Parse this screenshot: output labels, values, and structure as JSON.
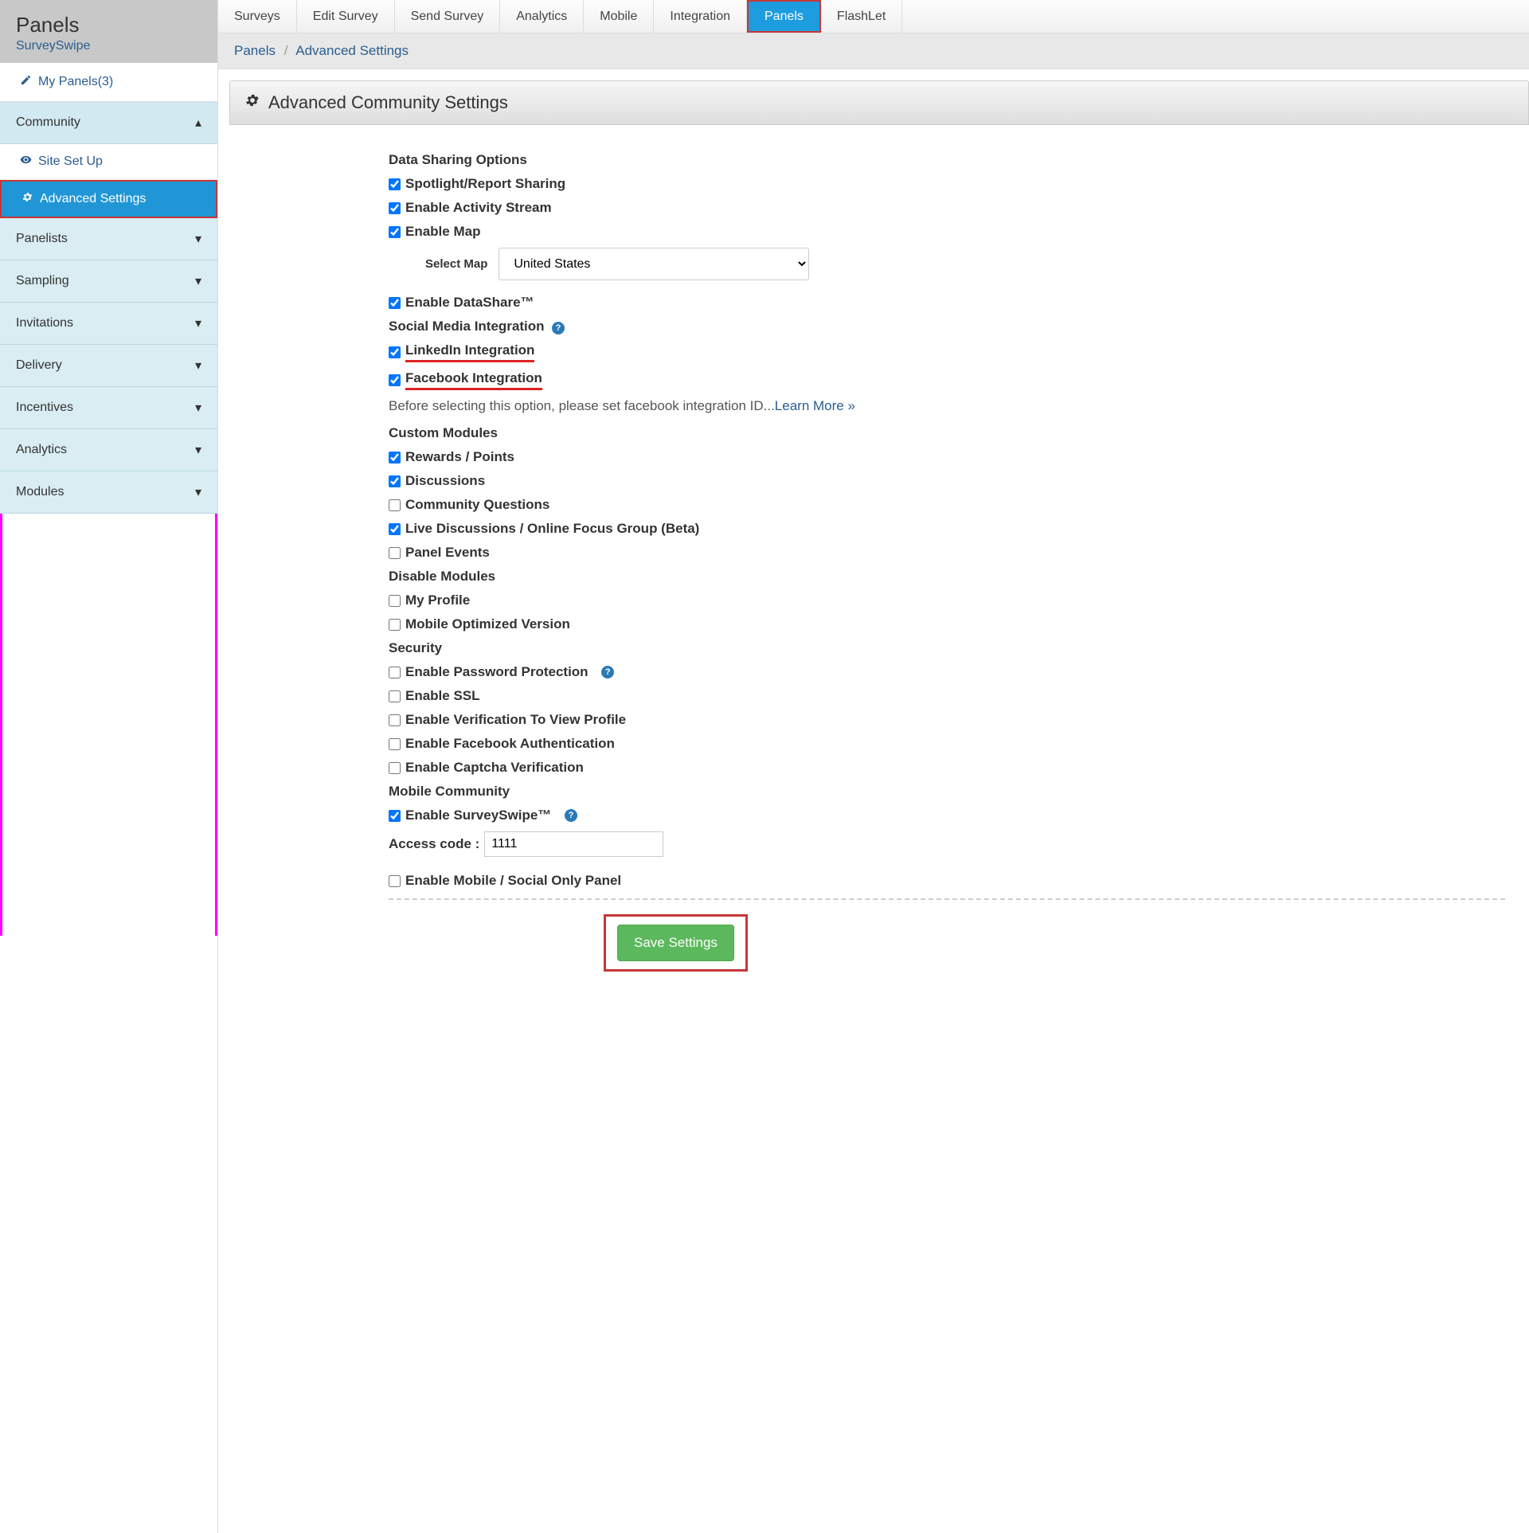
{
  "sidebar": {
    "title": "Panels",
    "subtitle": "SurveySwipe",
    "topItem": "My Panels(3)",
    "sections": {
      "community": {
        "label": "Community"
      },
      "siteSetup": {
        "label": "Site Set Up"
      },
      "advancedSettings": {
        "label": "Advanced Settings"
      },
      "panelists": {
        "label": "Panelists"
      },
      "sampling": {
        "label": "Sampling"
      },
      "invitations": {
        "label": "Invitations"
      },
      "delivery": {
        "label": "Delivery"
      },
      "incentives": {
        "label": "Incentives"
      },
      "analytics": {
        "label": "Analytics"
      },
      "modules": {
        "label": "Modules"
      }
    }
  },
  "topnav": {
    "items": [
      "Surveys",
      "Edit Survey",
      "Send Survey",
      "Analytics",
      "Mobile",
      "Integration",
      "Panels",
      "FlashLet"
    ]
  },
  "breadcrumb": {
    "a": "Panels",
    "b": "Advanced Settings"
  },
  "page": {
    "heading": "Advanced Community Settings",
    "sections": {
      "dataSharing": "Data Sharing Options",
      "socialMedia": "Social Media Integration",
      "customModules": "Custom Modules",
      "disableModules": "Disable Modules",
      "security": "Security",
      "mobileCommunity": "Mobile Community"
    },
    "checkboxes": {
      "spotlight": "Spotlight/Report Sharing",
      "activityStream": "Enable Activity Stream",
      "enableMap": "Enable Map",
      "datashare": "Enable DataShare™",
      "linkedin": "LinkedIn Integration",
      "facebook": "Facebook Integration",
      "rewards": "Rewards / Points",
      "discussions": "Discussions",
      "communityQuestions": "Community Questions",
      "liveDiscussions": "Live Discussions / Online Focus Group (Beta)",
      "panelEvents": "Panel Events",
      "myProfile": "My Profile",
      "mobileOptimized": "Mobile Optimized Version",
      "passwordProtection": "Enable Password Protection",
      "ssl": "Enable SSL",
      "verification": "Enable Verification To View Profile",
      "facebookAuth": "Enable Facebook Authentication",
      "captcha": "Enable Captcha Verification",
      "surveyswipe": "Enable SurveySwipe™",
      "socialOnly": "Enable Mobile / Social Only Panel"
    },
    "selectMap": {
      "label": "Select Map",
      "value": "United States"
    },
    "facebookNote": "Before selecting this option, please set facebook integration ID...",
    "learnMore": "Learn More »",
    "accessCode": {
      "label": "Access code :",
      "value": "1111"
    },
    "saveButton": "Save Settings",
    "helpIcon": "?"
  }
}
